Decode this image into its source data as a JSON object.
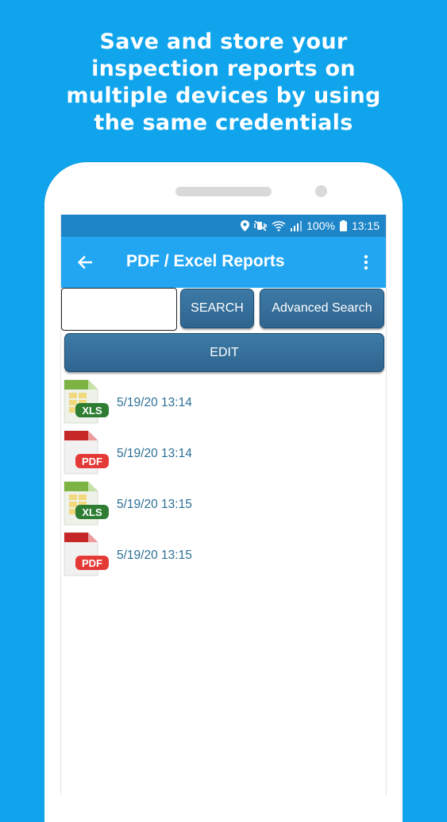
{
  "promo": {
    "headline_lines": [
      "Save and store your",
      "inspection reports on",
      "multiple devices by using",
      "the same credentials"
    ]
  },
  "status_bar": {
    "battery": "100%",
    "time": "13:15",
    "icons": [
      "location-icon",
      "mute-vibrate-icon",
      "wifi-icon",
      "signal-icon",
      "battery-icon"
    ]
  },
  "app_bar": {
    "title": "PDF / Excel Reports",
    "back_icon": "arrow-left-icon",
    "menu_icon": "more-vert-icon"
  },
  "search": {
    "input_value": "",
    "search_label": "SEARCH",
    "advanced_label": "Advanced Search",
    "edit_label": "EDIT"
  },
  "reports": [
    {
      "type": "XLS",
      "date": "5/19/20 13:14"
    },
    {
      "type": "PDF",
      "date": "5/19/20 13:14"
    },
    {
      "type": "XLS",
      "date": "5/19/20 13:15"
    },
    {
      "type": "PDF",
      "date": "5/19/20 13:15"
    }
  ],
  "colors": {
    "background": "#0fa4ec",
    "status_bar": "#1e86c8",
    "app_bar": "#22a6f2",
    "button": "#346e98",
    "date_text": "#2c6f96",
    "xls_badge": "#2e7d32",
    "pdf_badge": "#e53935"
  }
}
